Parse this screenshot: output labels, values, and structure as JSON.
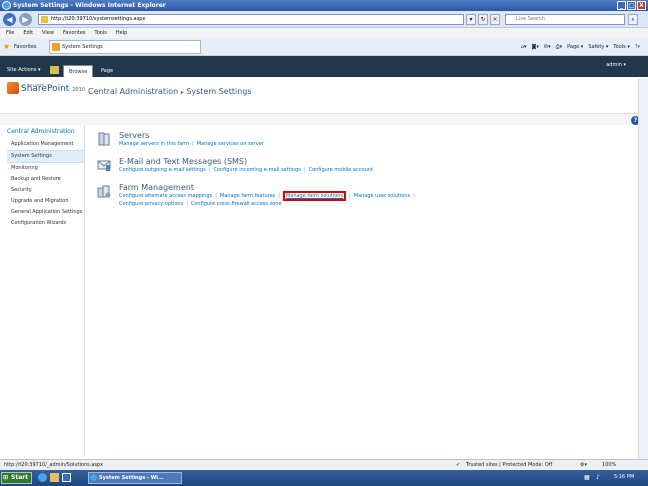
{
  "window": {
    "title": "System Settings - Windows Internet Explorer",
    "min": "_",
    "max": "□",
    "close": "X"
  },
  "address": {
    "url": "http://t20:39710/systemsettings.aspx",
    "search_placeholder": "Live Search"
  },
  "menu": [
    "File",
    "Edit",
    "View",
    "Favorites",
    "Tools",
    "Help"
  ],
  "favorites": {
    "label": "Favorites",
    "tab": "System Settings",
    "commands": [
      "Page ▾",
      "Safety ▾",
      "Tools ▾"
    ]
  },
  "ribbon": {
    "site_actions": "Site Actions ▾",
    "tabs": [
      "Browse",
      "Page"
    ],
    "user": "admin ▾"
  },
  "header": {
    "logo_small": "Microsoft®",
    "logo": "SharePoint",
    "logo_year": "2010",
    "crumb_root": "Central Administration",
    "crumb_sep": "▸",
    "crumb_page": "System Settings"
  },
  "sidebar": {
    "heading": "Central Administration",
    "items": [
      "Application Management",
      "System Settings",
      "Monitoring",
      "Backup and Restore",
      "Security",
      "Upgrade and Migration",
      "General Application Settings",
      "Configuration Wizards"
    ]
  },
  "sections": [
    {
      "title": "Servers",
      "links": [
        "Manage servers in this farm",
        "Manage services on server"
      ]
    },
    {
      "title": "E-Mail and Text Messages (SMS)",
      "links": [
        "Configure outgoing e-mail settings",
        "Configure incoming e-mail settings",
        "Configure mobile account"
      ]
    },
    {
      "title": "Farm Management",
      "links": [
        "Configure alternate access mappings",
        "Manage farm features",
        "Manage farm solutions",
        "Manage user solutions",
        "Configure privacy options",
        "Configure cross-firewall access zone"
      ]
    }
  ],
  "status": {
    "url": "http://t20:39710/_admin/Solutions.aspx",
    "zone": "Trusted sites | Protected Mode: Off",
    "zoom": "100%"
  },
  "taskbar": {
    "start": "Start",
    "item": "System Settings - Wi...",
    "clock": "5:16 PM"
  }
}
